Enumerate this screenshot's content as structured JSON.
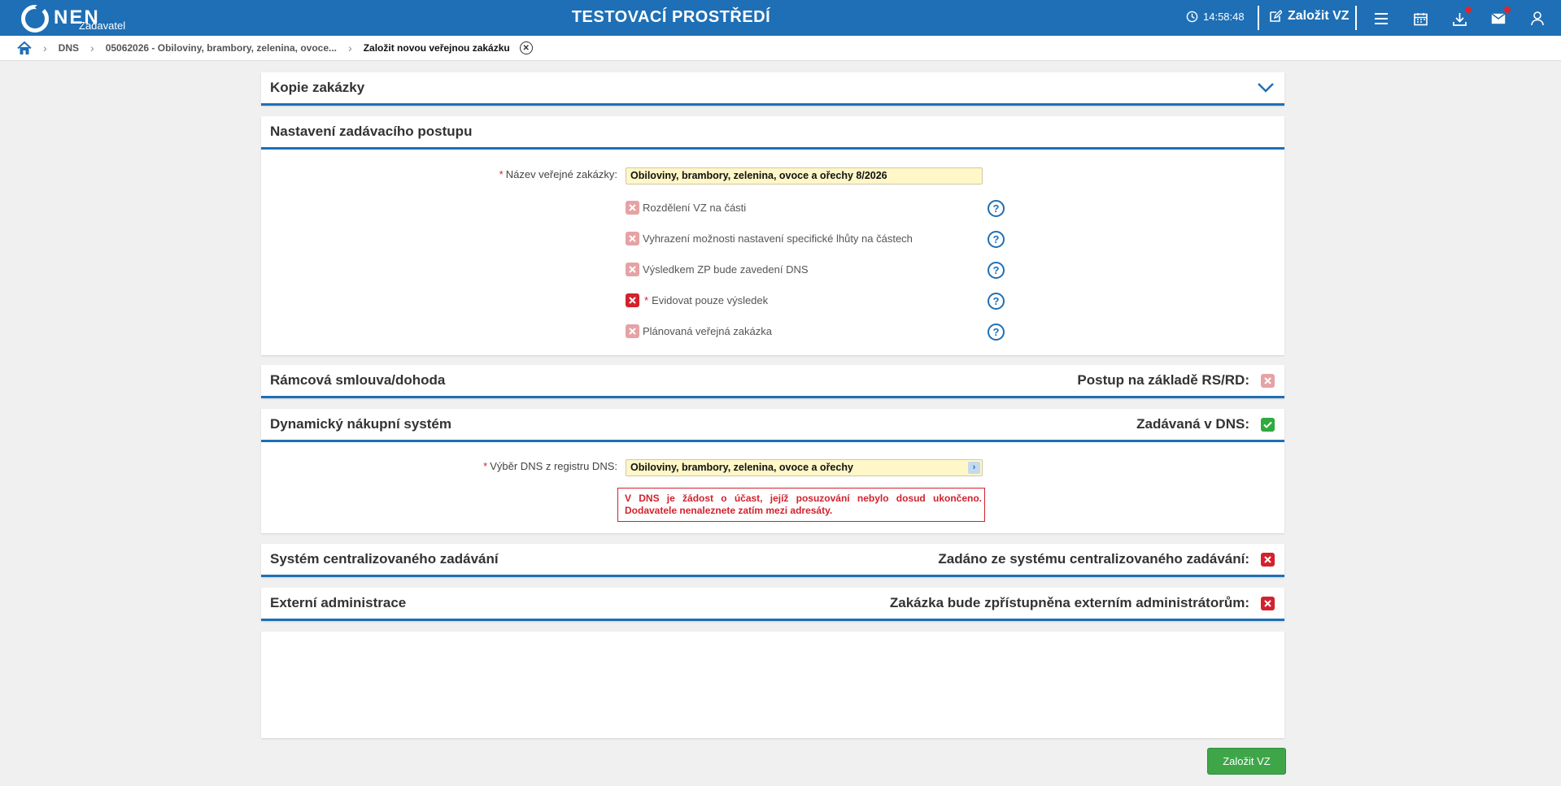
{
  "app": {
    "logo": "NEN",
    "role": "Zadavatel",
    "env_title": "TESTOVACÍ PROSTŘEDÍ",
    "clock": "14:58:48",
    "new_vz": "Založit VZ"
  },
  "toolbar_icons": [
    "menu-icon",
    "calendar-icon",
    "download-icon",
    "mail-icon",
    "user-icon"
  ],
  "breadcrumb": {
    "items": [
      "DNS",
      "05062026 - Obiloviny, brambory, zelenina, ovoce...",
      "Založit novou veřejnou zakázku"
    ]
  },
  "sections": {
    "copy": {
      "title": "Kopie zakázky"
    },
    "procedure": {
      "title": "Nastavení zadávacího postupu",
      "name_label": "Název veřejné zakázky:",
      "name_value": "Obiloviny, brambory, zelenina, ovoce a ořechy 8/2026",
      "options": [
        {
          "label": "Rozdělení VZ na části",
          "required": false,
          "state": "unchecked-disabled"
        },
        {
          "label": "Vyhrazení možnosti nastavení specifické lhůty na částech",
          "required": false,
          "state": "unchecked-disabled"
        },
        {
          "label": "Výsledkem ZP bude zavedení DNS",
          "required": false,
          "state": "unchecked-disabled"
        },
        {
          "label": "Evidovat pouze výsledek",
          "required": true,
          "state": "unchecked"
        },
        {
          "label": "Plánovaná veřejná zakázka",
          "required": false,
          "state": "unchecked-disabled"
        }
      ]
    },
    "framework": {
      "title": "Rámcová smlouva/dohoda",
      "right_label": "Postup na základě RS/RD:"
    },
    "dns": {
      "title": "Dynamický nákupní systém",
      "right_label": "Zadávaná v DNS:",
      "select_label": "Výběr DNS z registru DNS:",
      "select_value": "Obiloviny, brambory, zelenina, ovoce a ořechy",
      "warning": "V DNS je žádost o účast, jejíž posuzování nebylo dosud ukončeno. Dodavatele nenaleznete zatím mezi adresáty."
    },
    "central": {
      "title": "Systém centralizovaného zadávání",
      "right_label": "Zadáno ze systému centralizovaného zadávání:"
    },
    "external": {
      "title": "Externí administrace",
      "right_label": "Zakázka bude zpřístupněna externím administrátorům:"
    }
  },
  "submit_label": "Založit VZ",
  "colors": {
    "brand": "#1e6fb5",
    "error": "#d2222d",
    "success": "#3ea649",
    "input_bg": "#fff7c8"
  }
}
